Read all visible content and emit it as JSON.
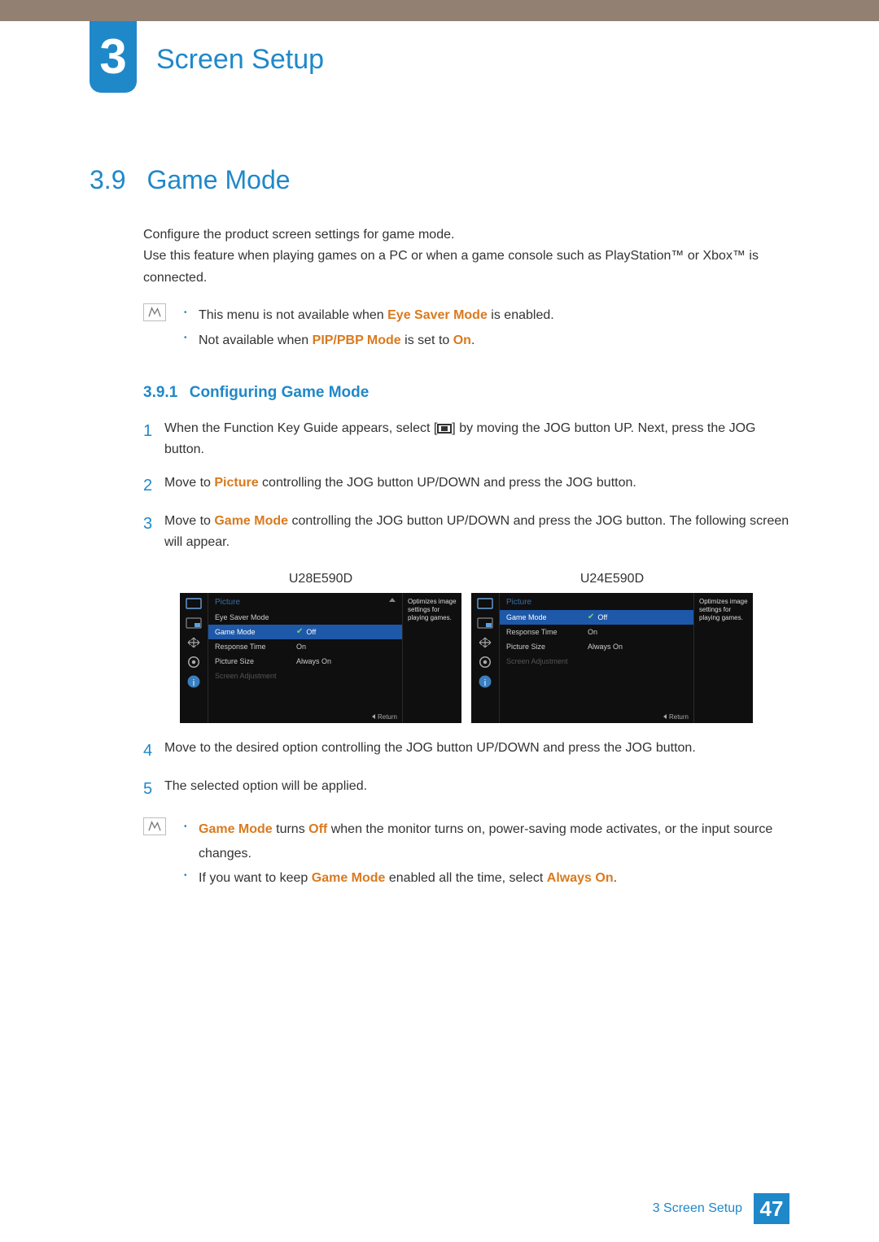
{
  "chapter": {
    "number": "3",
    "title": "Screen Setup"
  },
  "section": {
    "number": "3.9",
    "title": "Game Mode"
  },
  "intro": "Configure the product screen settings for game mode.\nUse this feature when playing games on a PC or when a game console such as PlayStation™ or Xbox™ is connected.",
  "note1": {
    "items": [
      {
        "prefix": "This menu is not available when ",
        "hl": "Eye Saver Mode",
        "suffix": " is enabled."
      },
      {
        "prefix": "Not available when ",
        "hl": "PIP/PBP Mode",
        "mid": " is set to ",
        "hl2": "On",
        "suffix": "."
      }
    ]
  },
  "subsection": {
    "number": "3.9.1",
    "title": "Configuring Game Mode"
  },
  "steps_a": [
    {
      "n": "1",
      "text_a": "When the Function Key Guide appears, select [",
      "text_b": "] by moving the JOG button UP. Next, press the JOG button."
    },
    {
      "n": "2",
      "text_a": "Move to ",
      "hl": "Picture",
      "text_b": " controlling the JOG button UP/DOWN and press the JOG button."
    },
    {
      "n": "3",
      "text_a": "Move to ",
      "hl": "Game Mode",
      "text_b": " controlling the JOG button UP/DOWN and press the JOG button. The following screen will appear."
    }
  ],
  "models": [
    {
      "label": "U28E590D",
      "heading": "Picture",
      "side": "Optimizes image settings for playing games.",
      "return": "Return",
      "rows": [
        {
          "l": "Eye Saver Mode",
          "r": "",
          "hl": false
        },
        {
          "l": "Game Mode",
          "r": "Off",
          "hl": true,
          "check": true
        },
        {
          "l": "Response Time",
          "r": "On",
          "hl": false
        },
        {
          "l": "Picture Size",
          "r": "Always On",
          "hl": false
        },
        {
          "l": "Screen Adjustment",
          "r": "",
          "hl": false,
          "dim": true
        }
      ]
    },
    {
      "label": "U24E590D",
      "heading": "Picture",
      "side": "Optimizes image settings for playing games.",
      "return": "Return",
      "rows": [
        {
          "l": "Game Mode",
          "r": "Off",
          "hl": true,
          "check": true
        },
        {
          "l": "Response Time",
          "r": "On",
          "hl": false
        },
        {
          "l": "Picture Size",
          "r": "Always On",
          "hl": false
        },
        {
          "l": "Screen Adjustment",
          "r": "",
          "hl": false,
          "dim": true
        }
      ]
    }
  ],
  "steps_b": [
    {
      "n": "4",
      "text": "Move to the desired option controlling the JOG button UP/DOWN and press the JOG button."
    },
    {
      "n": "5",
      "text": "The selected option will be applied."
    }
  ],
  "note2": {
    "items": [
      {
        "hl1": "Game Mode",
        "mid1": " turns ",
        "hl2": "Off",
        "suffix": " when the monitor turns on, power-saving mode activates, or the input source changes."
      },
      {
        "prefix": "If you want to keep ",
        "hl1": "Game Mode",
        "mid1": " enabled all the time, select ",
        "hl2": "Always On",
        "suffix": "."
      }
    ]
  },
  "footer": {
    "label": "3 Screen Setup",
    "page": "47"
  }
}
